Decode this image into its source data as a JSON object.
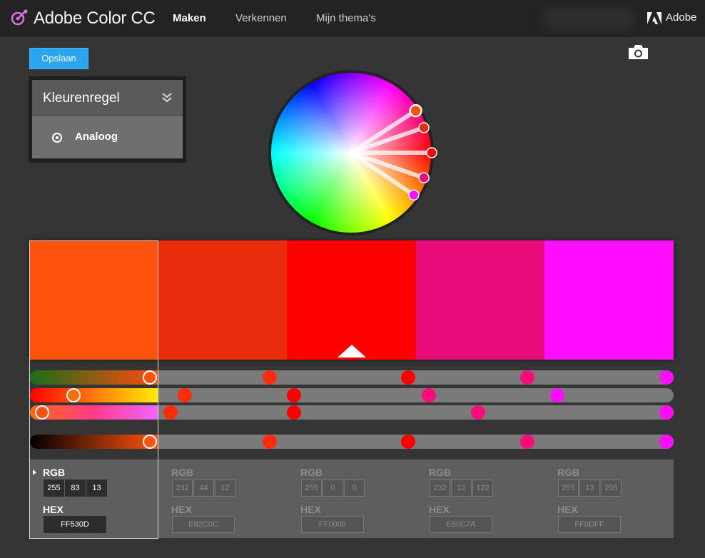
{
  "header": {
    "app_title": "Adobe Color CC",
    "nav": [
      {
        "label": "Maken",
        "active": true
      },
      {
        "label": "Verkennen",
        "active": false
      },
      {
        "label": "Mijn thema's",
        "active": false
      }
    ],
    "brand_label": "Adobe"
  },
  "toolbar": {
    "save_label": "Opslaan",
    "camera_icon": "camera-icon"
  },
  "rule_panel": {
    "title": "Kleurenregel",
    "selected_option": "Analoog"
  },
  "theme": {
    "active_index": 0,
    "colors": [
      {
        "hex": "FF530D",
        "rgb": [
          "255",
          "83",
          "13"
        ]
      },
      {
        "hex": "E82C0C",
        "rgb": [
          "232",
          "44",
          "12"
        ]
      },
      {
        "hex": "FF0000",
        "rgb": [
          "255",
          "0",
          "0"
        ]
      },
      {
        "hex": "E80C7A",
        "rgb": [
          "232",
          "12",
          "122"
        ]
      },
      {
        "hex": "FF0DFF",
        "rgb": [
          "255",
          "13",
          "255"
        ]
      }
    ]
  },
  "value_labels": {
    "rgb": "RGB",
    "hex": "HEX"
  }
}
